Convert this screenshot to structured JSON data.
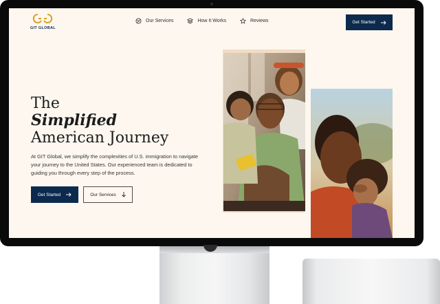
{
  "brand": {
    "name": "GIT GLOBAL",
    "accent": "#d7a21e",
    "primary": "#0c2a4d",
    "background": "#fdf7ef"
  },
  "nav": {
    "items": [
      {
        "label": "Our Services",
        "icon": "globe-icon"
      },
      {
        "label": "How It Works",
        "icon": "layers-icon"
      },
      {
        "label": "Reviews",
        "icon": "star-icon"
      }
    ],
    "cta": {
      "label": "Get Started",
      "icon": "arrow-right-icon"
    }
  },
  "hero": {
    "title_line1": "The",
    "title_line2": "Simplified",
    "title_line3": "American Journey",
    "description": "At GIT Global, we simplify the complexities of U.S. immigration to navigate your journey to the United States. Our experienced team is dedicated to guiding you through every step of the process.",
    "primary_button": {
      "label": "Get Started",
      "icon": "arrow-right-icon"
    },
    "secondary_button": {
      "label": "Our Services",
      "icon": "arrow-down-icon"
    }
  },
  "images": [
    {
      "name": "family-photo-1",
      "description_icon": "family-photo"
    },
    {
      "name": "family-photo-2",
      "description_icon": "father-daughter-photo"
    }
  ]
}
